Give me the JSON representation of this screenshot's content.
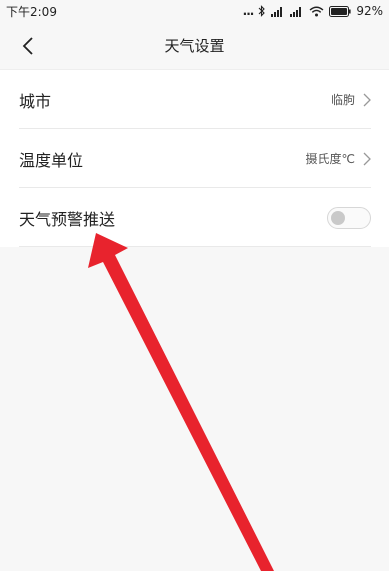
{
  "status_bar": {
    "time": "下午2:09",
    "dots": "...",
    "battery_percent": "92%"
  },
  "header": {
    "title": "天气设置",
    "back_icon": "chevron-left-icon"
  },
  "settings": {
    "city": {
      "label": "城市",
      "value": "临朐"
    },
    "temperature_unit": {
      "label": "温度单位",
      "value": "摄氏度℃"
    },
    "weather_alert_push": {
      "label": "天气预警推送",
      "enabled": false
    }
  },
  "colors": {
    "background": "#f7f7f7",
    "list_background": "#ffffff",
    "annotation_arrow": "#e8232d"
  }
}
